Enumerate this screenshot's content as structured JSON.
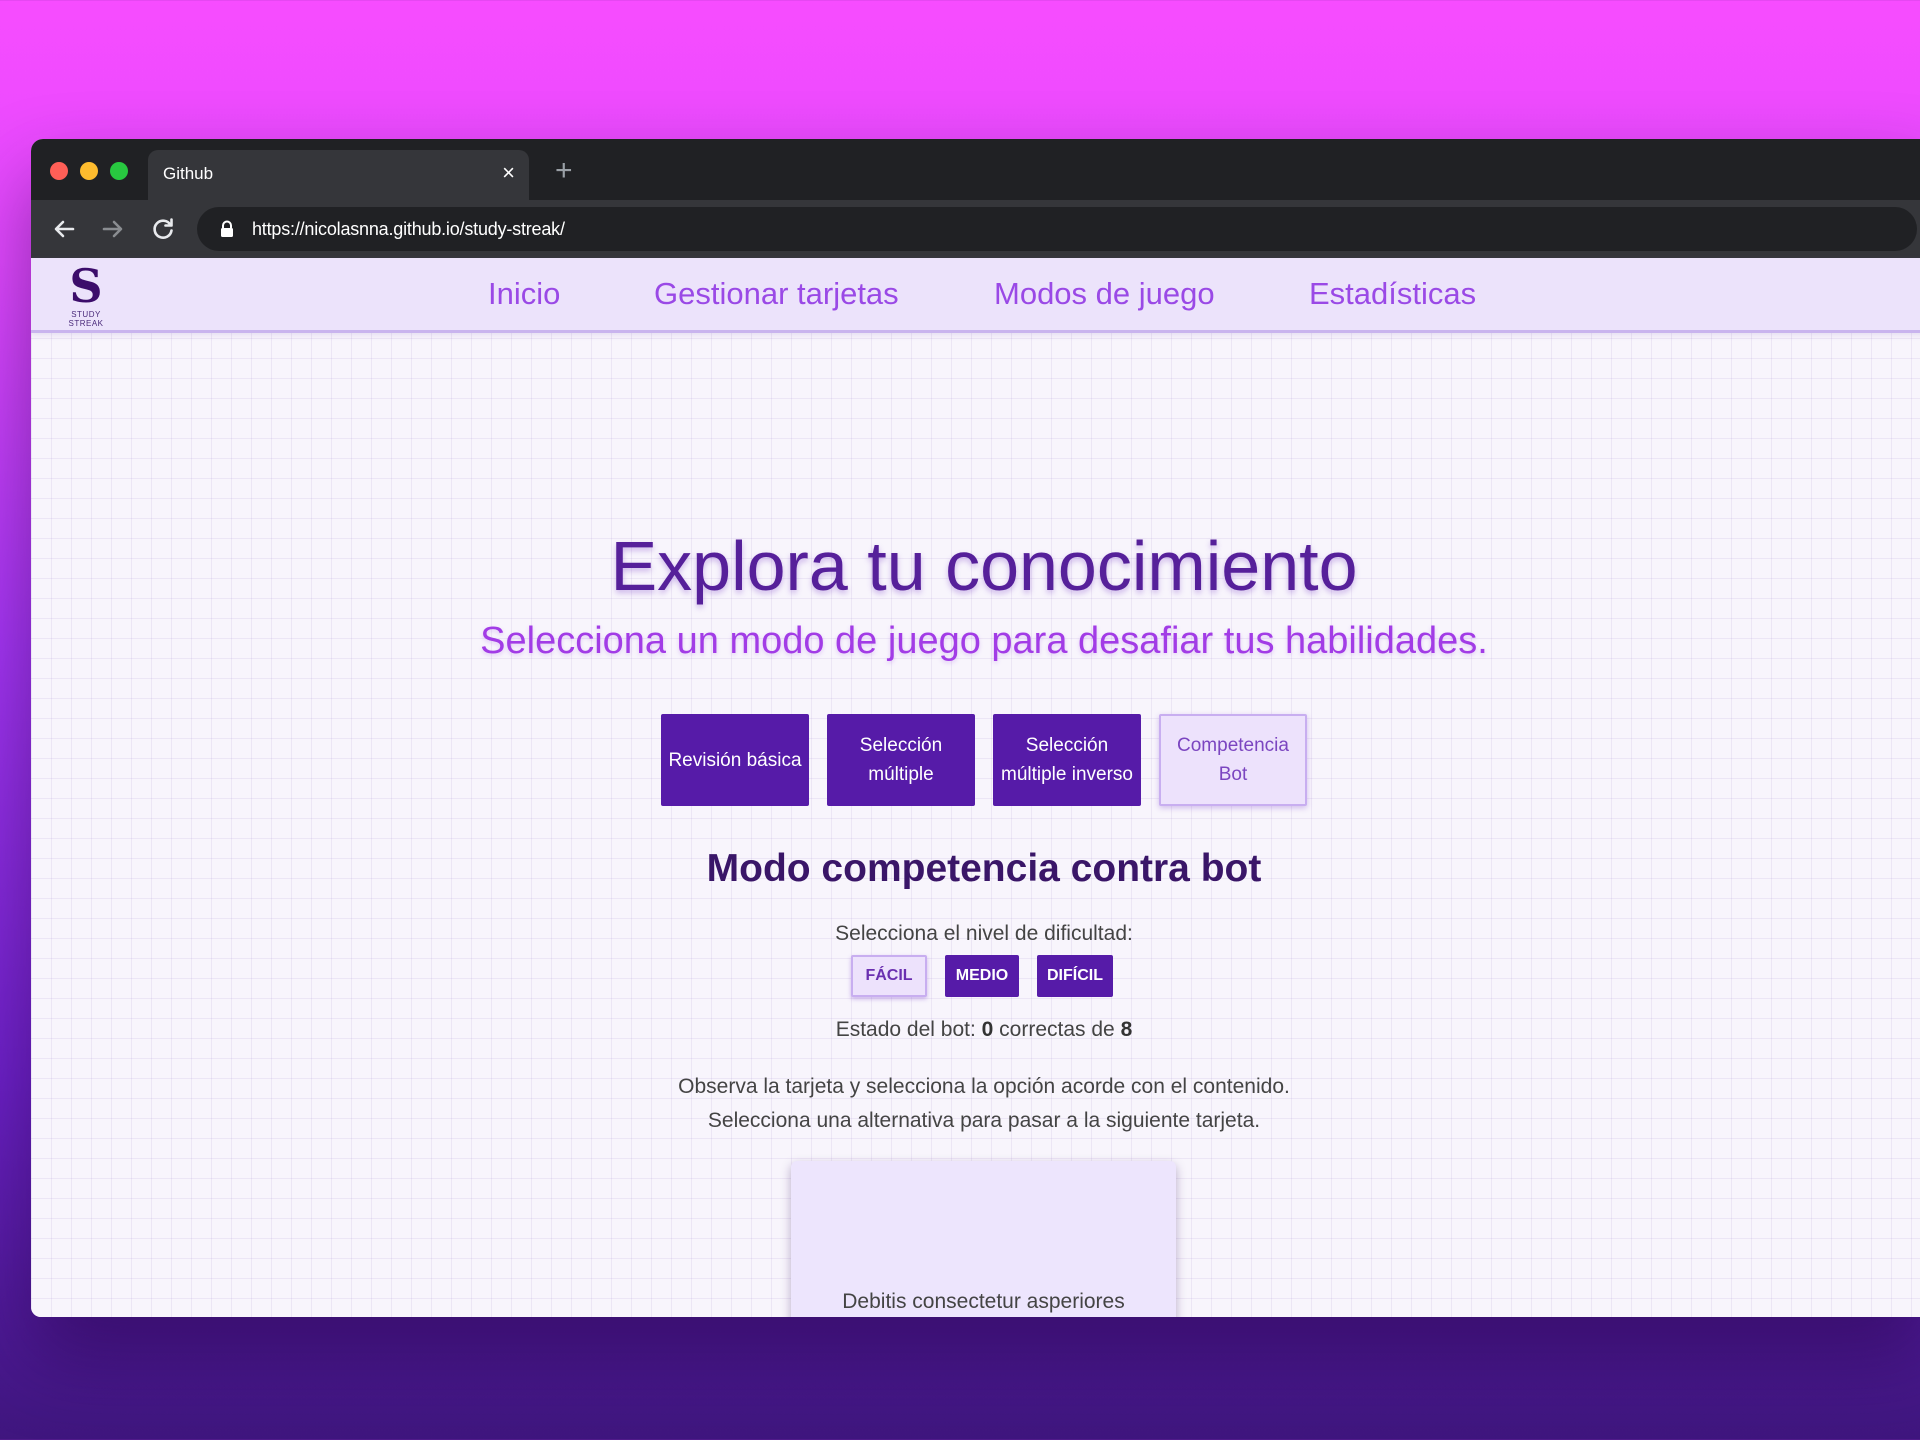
{
  "browser": {
    "tab_title": "Github",
    "tab_close_icon": "×",
    "new_tab_icon": "+",
    "url": "https://nicolasnna.github.io/study-streak/"
  },
  "navbar": {
    "logo_letter": "S",
    "logo_text": "STUDY STREAK",
    "links": [
      "Inicio",
      "Gestionar tarjetas",
      "Modos de juego",
      "Estadísticas"
    ]
  },
  "hero": {
    "title": "Explora tu conocimiento",
    "subtitle": "Selecciona un modo de juego para desafiar tus habilidades."
  },
  "modes": [
    {
      "label": "Revisión básica",
      "active": false
    },
    {
      "label": "Selección múltiple",
      "active": false
    },
    {
      "label": "Selección múltiple inverso",
      "active": false
    },
    {
      "label": "Competencia Bot",
      "active": true
    }
  ],
  "competition": {
    "title": "Modo competencia contra bot",
    "difficulty_label": "Selecciona el nivel de dificultad:",
    "difficulties": [
      {
        "label": "FÁCIL",
        "active": true
      },
      {
        "label": "MEDIO",
        "active": false
      },
      {
        "label": "DIFÍCIL",
        "active": false
      }
    ],
    "status_prefix": "Estado del bot: ",
    "correct": "0",
    "status_middle": " correctas de ",
    "total": "8",
    "instruction_1": "Observa la tarjeta y selecciona la opción acorde con el contenido.",
    "instruction_2": "Selecciona una alternativa para pasar a la siguiente tarjeta.",
    "card_text": "Debitis consectetur asperiores numquam repellendus a dolor n"
  },
  "colors": {
    "accent": "#561ba8",
    "nav_link": "#9a49e6",
    "title": "#56209a",
    "subtitle": "#a23ce6"
  }
}
